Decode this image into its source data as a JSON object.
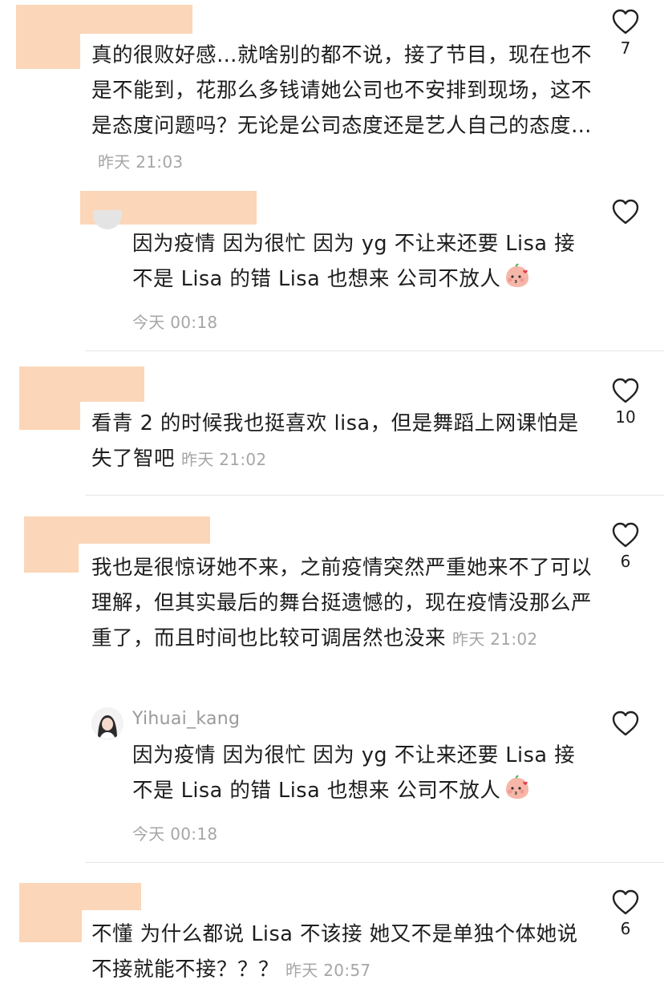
{
  "comments": [
    {
      "text": "真的很败好感…就啥别的都不说，接了节目，现在也不是不能到，花那么多钱请她公司也不安排到现场，这不是态度问题吗？无论是公司态度还是艺人自己的态度…",
      "time": "昨天 21:03",
      "likes": "7",
      "reply": {
        "username": "",
        "text": "因为疫情 因为很忙 因为 yg 不让来还要 Lisa 接 不是 Lisa 的错 Lisa 也想来 公司不放人",
        "time": "今天 00:18"
      }
    },
    {
      "text": "看青 2 的时候我也挺喜欢 lisa，但是舞蹈上网课怕是失了智吧",
      "time": "昨天 21:02",
      "likes": "10"
    },
    {
      "text": "我也是很惊讶她不来，之前疫情突然严重她来不了可以理解，但其实最后的舞台挺遗憾的，现在疫情没那么严重了，而且时间也比较可调居然也没来",
      "time": "昨天 21:02",
      "likes": "6",
      "reply": {
        "username": "Yihuai_kang",
        "text": "因为疫情 因为很忙 因为 yg 不让来还要 Lisa 接 不是 Lisa 的错 Lisa 也想来 公司不放人",
        "time": "今天 00:18"
      }
    },
    {
      "text": "不懂 为什么都说 Lisa 不该接 她又不是单独个体她说不接就能不接？？？",
      "time": "昨天 20:57",
      "likes": "6"
    }
  ],
  "icons": {
    "like": "heart-outline-icon",
    "emoji": "kissing-peach-emoji"
  },
  "colors": {
    "text": "#1d1d1d",
    "meta": "#a6a6a6",
    "redaction": "#fbd6b8",
    "divider": "#e6e6e6"
  }
}
